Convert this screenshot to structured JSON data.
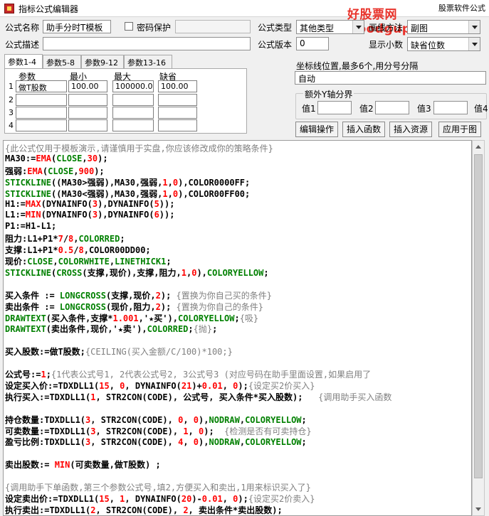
{
  "window": {
    "title": "指标公式编辑器"
  },
  "watermark": {
    "text": "好股票网Goodgupiao.com",
    "extra": "股票软件公式"
  },
  "form": {
    "name_label": "公式名称",
    "name_value": "助手分时T模板",
    "password_label": "密码保护",
    "password_value": "",
    "desc_label": "公式描述",
    "desc_value": "",
    "type_label": "公式类型",
    "type_value": "其他类型",
    "draw_label": "画线方法",
    "draw_value": "副图",
    "version_label": "公式版本",
    "version_value": "0",
    "decimal_label": "显示小数",
    "decimal_value": "缺省位数"
  },
  "params": {
    "tabs": [
      "参数1-4",
      "参数5-8",
      "参数9-12",
      "参数13-16"
    ],
    "headers": [
      "参数",
      "最小",
      "最大",
      "缺省"
    ],
    "rows": [
      {
        "num": "1",
        "name": "做T股数",
        "min": "100.00",
        "max": "100000.00",
        "def": "100.00"
      },
      {
        "num": "2",
        "name": "",
        "min": "",
        "max": "",
        "def": ""
      },
      {
        "num": "3",
        "name": "",
        "min": "",
        "max": "",
        "def": ""
      },
      {
        "num": "4",
        "name": "",
        "min": "",
        "max": "",
        "def": ""
      }
    ]
  },
  "coords": {
    "label": "坐标线位置,最多6个,用分号分隔",
    "value": "自动"
  },
  "yaxis": {
    "label": "额外Y轴分界",
    "fields": [
      {
        "label": "值1",
        "value": ""
      },
      {
        "label": "值2",
        "value": ""
      },
      {
        "label": "值3",
        "value": ""
      },
      {
        "label": "值4",
        "value": ""
      }
    ]
  },
  "buttons": {
    "edit": "编辑操作",
    "insert_func": "插入函数",
    "insert_res": "插入资源",
    "apply": "应用于图"
  },
  "colors": {
    "comment": "#808080",
    "keyword": "#008000",
    "function": "#ff0000",
    "number": "#ff0000",
    "accent_purple": "#800080"
  },
  "code": [
    [
      {
        "t": "{此公式仅用于模板演示,请谨慎用于实盘,你应该修改成你的策略条件}",
        "c": "#808080",
        "nb": true
      }
    ],
    [
      {
        "t": "MA30:=",
        "c": "#000000"
      },
      {
        "t": "EMA",
        "c": "#ff0000"
      },
      {
        "t": "(",
        "c": "#000000"
      },
      {
        "t": "CLOSE",
        "c": "#008000"
      },
      {
        "t": ",",
        "c": "#000000"
      },
      {
        "t": "30",
        "c": "#ff0000"
      },
      {
        "t": ");",
        "c": "#000000"
      }
    ],
    [
      {
        "t": "强弱:",
        "c": "#000000"
      },
      {
        "t": "EMA",
        "c": "#ff0000"
      },
      {
        "t": "(",
        "c": "#000000"
      },
      {
        "t": "CLOSE",
        "c": "#008000"
      },
      {
        "t": ",",
        "c": "#000000"
      },
      {
        "t": "900",
        "c": "#ff0000"
      },
      {
        "t": ");",
        "c": "#000000"
      }
    ],
    [
      {
        "t": "STICKLINE",
        "c": "#008000"
      },
      {
        "t": "((MA30>强弱),MA30,强弱,",
        "c": "#000000"
      },
      {
        "t": "1",
        "c": "#ff0000"
      },
      {
        "t": ",",
        "c": "#000000"
      },
      {
        "t": "0",
        "c": "#ff0000"
      },
      {
        "t": "),COLOR0000FF;",
        "c": "#000000"
      }
    ],
    [
      {
        "t": "STICKLINE",
        "c": "#008000"
      },
      {
        "t": "((MA30<强弱),MA30,强弱,",
        "c": "#000000"
      },
      {
        "t": "1",
        "c": "#ff0000"
      },
      {
        "t": ",",
        "c": "#000000"
      },
      {
        "t": "0",
        "c": "#ff0000"
      },
      {
        "t": "),COLOR00FF00;",
        "c": "#000000"
      }
    ],
    [
      {
        "t": "H1:=",
        "c": "#000000"
      },
      {
        "t": "MAX",
        "c": "#ff0000"
      },
      {
        "t": "(DYNAINFO(",
        "c": "#000000"
      },
      {
        "t": "3",
        "c": "#ff0000"
      },
      {
        "t": "),DYNAINFO(",
        "c": "#000000"
      },
      {
        "t": "5",
        "c": "#ff0000"
      },
      {
        "t": "));",
        "c": "#000000"
      }
    ],
    [
      {
        "t": "L1:=",
        "c": "#000000"
      },
      {
        "t": "MIN",
        "c": "#ff0000"
      },
      {
        "t": "(DYNAINFO(",
        "c": "#000000"
      },
      {
        "t": "3",
        "c": "#ff0000"
      },
      {
        "t": "),DYNAINFO(",
        "c": "#000000"
      },
      {
        "t": "6",
        "c": "#ff0000"
      },
      {
        "t": "));",
        "c": "#000000"
      }
    ],
    [
      {
        "t": "P1:=H1-L1;",
        "c": "#000000"
      }
    ],
    [
      {
        "t": "阻力:L1+P1*",
        "c": "#000000"
      },
      {
        "t": "7",
        "c": "#ff0000"
      },
      {
        "t": "/",
        "c": "#000000"
      },
      {
        "t": "8",
        "c": "#ff0000"
      },
      {
        "t": ",",
        "c": "#000000"
      },
      {
        "t": "COLORRED",
        "c": "#008000"
      },
      {
        "t": ";",
        "c": "#000000"
      }
    ],
    [
      {
        "t": "支撑:L1+P1*",
        "c": "#000000"
      },
      {
        "t": "0.5",
        "c": "#ff0000"
      },
      {
        "t": "/",
        "c": "#000000"
      },
      {
        "t": "8",
        "c": "#ff0000"
      },
      {
        "t": ",COLOR00DD00;",
        "c": "#000000"
      }
    ],
    [
      {
        "t": "现价:",
        "c": "#000000"
      },
      {
        "t": "CLOSE",
        "c": "#008000"
      },
      {
        "t": ",",
        "c": "#000000"
      },
      {
        "t": "COLORWHITE",
        "c": "#008000"
      },
      {
        "t": ",",
        "c": "#000000"
      },
      {
        "t": "LINETHICK1",
        "c": "#008000"
      },
      {
        "t": ";",
        "c": "#000000"
      }
    ],
    [
      {
        "t": "STICKLINE",
        "c": "#008000"
      },
      {
        "t": "(",
        "c": "#000000"
      },
      {
        "t": "CROSS",
        "c": "#008000"
      },
      {
        "t": "(支撑,现价),支撑,阻力,",
        "c": "#000000"
      },
      {
        "t": "1",
        "c": "#ff0000"
      },
      {
        "t": ",",
        "c": "#000000"
      },
      {
        "t": "0",
        "c": "#ff0000"
      },
      {
        "t": "),",
        "c": "#000000"
      },
      {
        "t": "COLORYELLOW",
        "c": "#008000"
      },
      {
        "t": ";",
        "c": "#000000"
      }
    ],
    [],
    [
      {
        "t": "买入条件 := ",
        "c": "#000000"
      },
      {
        "t": "LONGCROSS",
        "c": "#008000"
      },
      {
        "t": "(支撑,现价,",
        "c": "#000000"
      },
      {
        "t": "2",
        "c": "#ff0000"
      },
      {
        "t": "); ",
        "c": "#000000"
      },
      {
        "t": "{置换为你自己买的条件}",
        "c": "#808080",
        "nb": true
      }
    ],
    [
      {
        "t": "卖出条件 := ",
        "c": "#000000"
      },
      {
        "t": "LONGCROSS",
        "c": "#008000"
      },
      {
        "t": "(现价,阻力,",
        "c": "#000000"
      },
      {
        "t": "2",
        "c": "#ff0000"
      },
      {
        "t": "); ",
        "c": "#000000"
      },
      {
        "t": "{置换为你自己的条件}",
        "c": "#808080",
        "nb": true
      }
    ],
    [
      {
        "t": "DRAWTEXT",
        "c": "#008000"
      },
      {
        "t": "(买入条件,支撑*",
        "c": "#000000"
      },
      {
        "t": "1.001",
        "c": "#ff0000"
      },
      {
        "t": ",'★买'),",
        "c": "#000000"
      },
      {
        "t": "COLORYELLOW",
        "c": "#008000"
      },
      {
        "t": ";",
        "c": "#000000"
      },
      {
        "t": "{吸}",
        "c": "#808080",
        "nb": true
      }
    ],
    [
      {
        "t": "DRAWTEXT",
        "c": "#008000"
      },
      {
        "t": "(卖出条件,现价,'★卖'),",
        "c": "#000000"
      },
      {
        "t": "COLORRED",
        "c": "#008000"
      },
      {
        "t": ";",
        "c": "#000000"
      },
      {
        "t": "{抛}",
        "c": "#808080",
        "nb": true
      },
      {
        "t": ";",
        "c": "#000000"
      }
    ],
    [],
    [
      {
        "t": "买入股数:=做T股数;",
        "c": "#000000"
      },
      {
        "t": "{CEILING(买入金额/C/100)*100;}",
        "c": "#808080",
        "nb": true
      }
    ],
    [],
    [
      {
        "t": "公式号:=",
        "c": "#000000"
      },
      {
        "t": "1",
        "c": "#ff0000"
      },
      {
        "t": ";",
        "c": "#000000"
      },
      {
        "t": "{1代表公式号1, 2代表公式号2, 3公式号3 (对应号码在助手里面设置,如果启用了",
        "c": "#808080",
        "nb": true
      }
    ],
    [
      {
        "t": "设定买入价:=TDXDLL1(",
        "c": "#000000"
      },
      {
        "t": "15",
        "c": "#ff0000"
      },
      {
        "t": ", ",
        "c": "#000000"
      },
      {
        "t": "0",
        "c": "#ff0000"
      },
      {
        "t": ", DYNAINFO(",
        "c": "#000000"
      },
      {
        "t": "21",
        "c": "#ff0000"
      },
      {
        "t": ")+",
        "c": "#000000"
      },
      {
        "t": "0.01",
        "c": "#ff0000"
      },
      {
        "t": ", ",
        "c": "#000000"
      },
      {
        "t": "0",
        "c": "#ff0000"
      },
      {
        "t": ");",
        "c": "#000000"
      },
      {
        "t": "{设定买2价买入}",
        "c": "#808080",
        "nb": true
      }
    ],
    [
      {
        "t": "执行买入:=TDXDLL1(",
        "c": "#000000"
      },
      {
        "t": "1",
        "c": "#ff0000"
      },
      {
        "t": ", STR2CON(CODE), 公式号, 买入条件*买入股数);   ",
        "c": "#000000"
      },
      {
        "t": "{调用助手买入函数",
        "c": "#808080",
        "nb": true
      }
    ],
    [],
    [
      {
        "t": "持仓数量:TDXDLL1(",
        "c": "#000000"
      },
      {
        "t": "3",
        "c": "#ff0000"
      },
      {
        "t": ", STR2CON(CODE), ",
        "c": "#000000"
      },
      {
        "t": "0",
        "c": "#ff0000"
      },
      {
        "t": ", ",
        "c": "#000000"
      },
      {
        "t": "0",
        "c": "#ff0000"
      },
      {
        "t": "),",
        "c": "#000000"
      },
      {
        "t": "NODRAW",
        "c": "#008000"
      },
      {
        "t": ",",
        "c": "#000000"
      },
      {
        "t": "COLORYELLOW",
        "c": "#008000"
      },
      {
        "t": ";",
        "c": "#000000"
      }
    ],
    [
      {
        "t": "可卖数量:=TDXDLL1(",
        "c": "#000000"
      },
      {
        "t": "3",
        "c": "#ff0000"
      },
      {
        "t": ", STR2CON(CODE), ",
        "c": "#000000"
      },
      {
        "t": "1",
        "c": "#ff0000"
      },
      {
        "t": ", ",
        "c": "#000000"
      },
      {
        "t": "0",
        "c": "#ff0000"
      },
      {
        "t": ");  ",
        "c": "#000000"
      },
      {
        "t": "{检测是否有可卖持仓}",
        "c": "#808080",
        "nb": true
      }
    ],
    [
      {
        "t": "盈亏比例:TDXDLL1(",
        "c": "#000000"
      },
      {
        "t": "3",
        "c": "#ff0000"
      },
      {
        "t": ", STR2CON(CODE), ",
        "c": "#000000"
      },
      {
        "t": "4",
        "c": "#ff0000"
      },
      {
        "t": ", ",
        "c": "#000000"
      },
      {
        "t": "0",
        "c": "#ff0000"
      },
      {
        "t": "),",
        "c": "#000000"
      },
      {
        "t": "NODRAW",
        "c": "#008000"
      },
      {
        "t": ",",
        "c": "#000000"
      },
      {
        "t": "COLORYELLOW",
        "c": "#008000"
      },
      {
        "t": ";",
        "c": "#000000"
      }
    ],
    [],
    [
      {
        "t": "卖出股数:= ",
        "c": "#000000"
      },
      {
        "t": "MIN",
        "c": "#ff0000"
      },
      {
        "t": "(可卖数量,做T股数) ;",
        "c": "#000000"
      }
    ],
    [],
    [
      {
        "t": "{调用助手下单函数,第三个参数公式号,填2,方便买入和卖出,1用来标识买入了}",
        "c": "#808080",
        "nb": true
      }
    ],
    [
      {
        "t": "设定卖出价:=TDXDLL1(",
        "c": "#000000"
      },
      {
        "t": "15",
        "c": "#ff0000"
      },
      {
        "t": ", ",
        "c": "#000000"
      },
      {
        "t": "1",
        "c": "#ff0000"
      },
      {
        "t": ", DYNAINFO(",
        "c": "#000000"
      },
      {
        "t": "20",
        "c": "#ff0000"
      },
      {
        "t": ")-",
        "c": "#000000"
      },
      {
        "t": "0.01",
        "c": "#ff0000"
      },
      {
        "t": ", ",
        "c": "#000000"
      },
      {
        "t": "0",
        "c": "#ff0000"
      },
      {
        "t": ");",
        "c": "#000000"
      },
      {
        "t": "{设定买2价卖入}",
        "c": "#808080",
        "nb": true
      }
    ],
    [
      {
        "t": "执行卖出:=TDXDLL1(",
        "c": "#000000"
      },
      {
        "t": "2",
        "c": "#ff0000"
      },
      {
        "t": ", STR2CON(CODE), ",
        "c": "#000000"
      },
      {
        "t": "2",
        "c": "#ff0000"
      },
      {
        "t": ", 卖出条件*卖出股数);",
        "c": "#000000"
      }
    ]
  ]
}
